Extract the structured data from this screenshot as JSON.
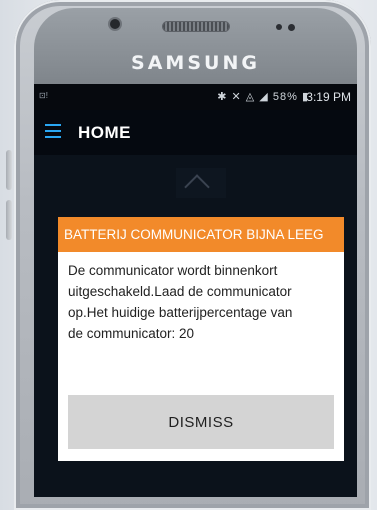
{
  "phone": {
    "brand": "SAMSUNG"
  },
  "status_bar": {
    "left_text": "⊡!",
    "icons_text": "✱ ✕ ◬ ◢",
    "battery": "58%",
    "battery_glyph": "▮",
    "time": "3:19 PM"
  },
  "app_bar": {
    "title": "HOME"
  },
  "dialog": {
    "title": "BATTERIJ COMMUNICATOR BIJNA LEEG",
    "message": "De communicator wordt binnenkort uitgeschakeld.Laad de communicator op.Het huidige batterijpercentage van de communicator: 20",
    "dismiss_label": "DISMISS"
  },
  "colors": {
    "dialog_header": "#f28a2a",
    "menu_icon": "#2aa7f3",
    "dismiss_button": "#d4d4d4",
    "screen_background": "#0b121b"
  }
}
